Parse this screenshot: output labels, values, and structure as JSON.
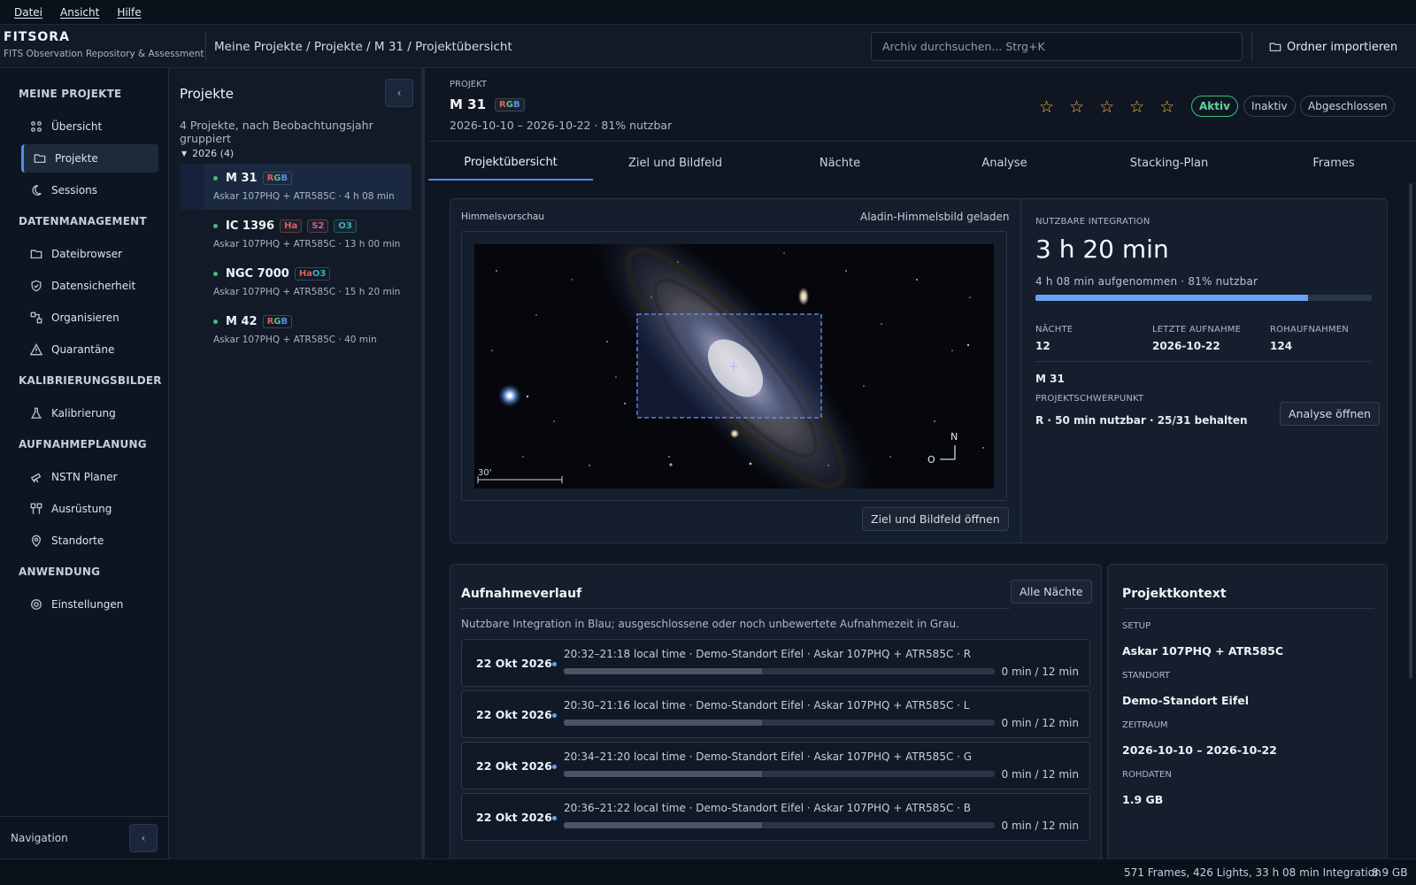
{
  "menu": [
    "Datei",
    "Ansicht",
    "Hilfe"
  ],
  "app": {
    "name": "FITSORA",
    "subtitle": "FITS Observation Repository & Assessment"
  },
  "breadcrumb": "Meine Projekte / Projekte / M 31 / Projektübersicht",
  "search": {
    "placeholder": "Archiv durchsuchen...  Strg+K"
  },
  "import_label": "Ordner importieren",
  "sidebar": {
    "sections": [
      "MEINE PROJEKTE",
      "DATENMANAGEMENT",
      "KALIBRIERUNGSBILDER",
      "AUFNAHMEPLANUNG",
      "ANWENDUNG"
    ],
    "items": [
      {
        "label": "Übersicht",
        "icon": "grid-icon"
      },
      {
        "label": "Projekte",
        "icon": "folder-icon"
      },
      {
        "label": "Sessions",
        "icon": "moon-icon"
      },
      {
        "label": "Dateibrowser",
        "icon": "folder-icon"
      },
      {
        "label": "Datensicherheit",
        "icon": "shield-icon"
      },
      {
        "label": "Organisieren",
        "icon": "organize-icon"
      },
      {
        "label": "Quarantäne",
        "icon": "warning-icon"
      },
      {
        "label": "Kalibrierung",
        "icon": "flask-icon"
      },
      {
        "label": "NSTN Planer",
        "icon": "telescope-icon"
      },
      {
        "label": "Ausrüstung",
        "icon": "equipment-icon"
      },
      {
        "label": "Standorte",
        "icon": "pin-icon"
      },
      {
        "label": "Einstellungen",
        "icon": "gear-icon"
      }
    ],
    "footer": "Navigation",
    "collapse": "‹"
  },
  "projects": {
    "title": "Projekte",
    "subtitle": "4 Projekte, nach Beobachtungsjahr gruppiert",
    "group": "2026 (4)",
    "list": [
      {
        "name": "M 31",
        "tags": [
          {
            "t": "RGB",
            "k": "rgb"
          }
        ],
        "desc": "Askar 107PHQ + ATR585C · 4 h 08 min"
      },
      {
        "name": "IC 1396",
        "tags": [
          {
            "t": "Ha",
            "k": "ha"
          },
          {
            "t": "S2",
            "k": "s2"
          },
          {
            "t": "O3",
            "k": "o3"
          }
        ],
        "desc": "Askar 107PHQ + ATR585C · 13 h 00 min"
      },
      {
        "name": "NGC 7000",
        "tags": [
          {
            "t": "HaO3",
            "k": "hao3"
          }
        ],
        "desc": "Askar 107PHQ + ATR585C · 15 h 20 min"
      },
      {
        "name": "M 42",
        "tags": [
          {
            "t": "RGB",
            "k": "rgb"
          }
        ],
        "desc": "Askar 107PHQ + ATR585C · 40 min"
      }
    ]
  },
  "project": {
    "label": "PROJEKT",
    "name": "M 31",
    "tag": "RGB",
    "meta": "2026-10-10 – 2026-10-22  ·  81% nutzbar",
    "stars": [
      "☆",
      "☆",
      "☆",
      "☆",
      "☆"
    ],
    "status": [
      "Aktiv",
      "Inaktiv",
      "Abgeschlossen"
    ]
  },
  "tabs": [
    "Projektübersicht",
    "Ziel und Bildfeld",
    "Nächte",
    "Analyse",
    "Stacking-Plan",
    "Frames"
  ],
  "preview": {
    "label": "Himmelsvorschau",
    "status": "Aladin-Himmelsbild geladen",
    "scale": "30'",
    "north": "N",
    "east": "O",
    "button": "Ziel und Bildfeld öffnen"
  },
  "integration": {
    "label": "NUTZBARE INTEGRATION",
    "value": "3 h 20 min",
    "sub": "4 h 08 min aufgenommen · 81% nutzbar",
    "fraction": 0.81,
    "stats": [
      {
        "k": "NÄCHTE",
        "v": "12"
      },
      {
        "k": "LETZTE AUFNAHME",
        "v": "2026-10-22"
      },
      {
        "k": "ROHAUFNAHMEN",
        "v": "124"
      }
    ],
    "target": "M 31",
    "focus_label": "PROJEKTSCHWERPUNKT",
    "focus_value": "R · 50 min nutzbar · 25/31 behalten",
    "button": "Analyse öffnen"
  },
  "history": {
    "title": "Aufnahmeverlauf",
    "button": "Alle Nächte",
    "subtitle": "Nutzbare Integration in Blau; ausgeschlossene oder noch unbewertete Aufnahmezeit in Grau.",
    "nights": [
      {
        "date": "22 Okt 2026",
        "desc": "20:32–21:18 local time · Demo-Standort Eifel · Askar 107PHQ + ATR585C · R",
        "value": "0 min / 12 min",
        "grey": 0.46
      },
      {
        "date": "22 Okt 2026",
        "desc": "20:30–21:16 local time · Demo-Standort Eifel · Askar 107PHQ + ATR585C · L",
        "value": "0 min / 12 min",
        "grey": 0.46
      },
      {
        "date": "22 Okt 2026",
        "desc": "20:34–21:20 local time · Demo-Standort Eifel · Askar 107PHQ + ATR585C · G",
        "value": "0 min / 12 min",
        "grey": 0.46
      },
      {
        "date": "22 Okt 2026",
        "desc": "20:36–21:22 local time · Demo-Standort Eifel · Askar 107PHQ + ATR585C · B",
        "value": "0 min / 12 min",
        "grey": 0.46
      }
    ]
  },
  "context": {
    "title": "Projektkontext",
    "rows": [
      {
        "k": "SETUP",
        "v": "Askar 107PHQ + ATR585C"
      },
      {
        "k": "STANDORT",
        "v": "Demo-Standort Eifel"
      },
      {
        "k": "ZEITRAUM",
        "v": "2026-10-10 – 2026-10-22"
      },
      {
        "k": "ROHDATEN",
        "v": "1.9 GB"
      }
    ]
  },
  "statusbar": {
    "left": "571 Frames, 426 Lights, 33 h 08 min Integration",
    "right": "8.9 GB"
  },
  "colors": {
    "accent": "#4e8ff0",
    "active": "#3fbf7f",
    "star": "#f0b33a",
    "ha": "#e0605a",
    "s2": "#d0607a",
    "o3": "#3ab0c0"
  }
}
